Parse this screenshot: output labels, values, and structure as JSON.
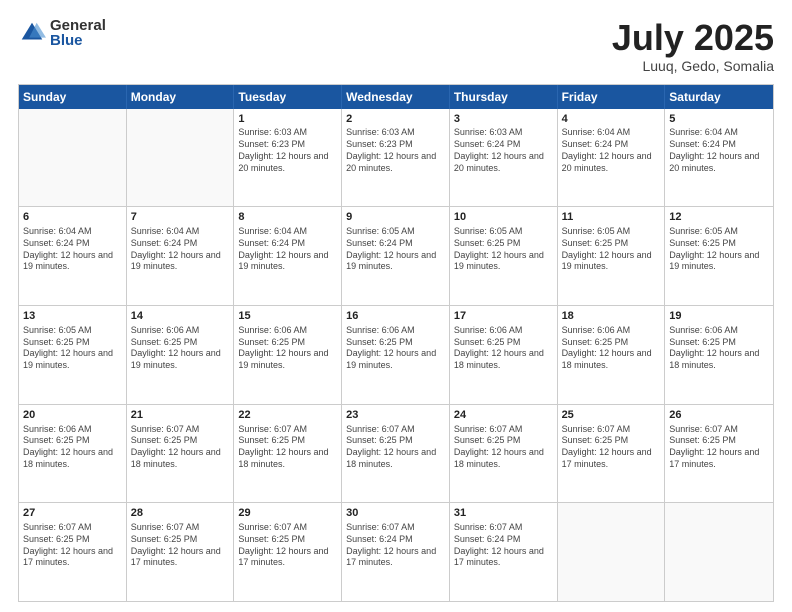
{
  "logo": {
    "general": "General",
    "blue": "Blue"
  },
  "title": "July 2025",
  "location": "Luuq, Gedo, Somalia",
  "days": [
    "Sunday",
    "Monday",
    "Tuesday",
    "Wednesday",
    "Thursday",
    "Friday",
    "Saturday"
  ],
  "weeks": [
    [
      {
        "day": "",
        "sunrise": "",
        "sunset": "",
        "daylight": ""
      },
      {
        "day": "",
        "sunrise": "",
        "sunset": "",
        "daylight": ""
      },
      {
        "day": "1",
        "sunrise": "Sunrise: 6:03 AM",
        "sunset": "Sunset: 6:23 PM",
        "daylight": "Daylight: 12 hours and 20 minutes."
      },
      {
        "day": "2",
        "sunrise": "Sunrise: 6:03 AM",
        "sunset": "Sunset: 6:23 PM",
        "daylight": "Daylight: 12 hours and 20 minutes."
      },
      {
        "day": "3",
        "sunrise": "Sunrise: 6:03 AM",
        "sunset": "Sunset: 6:24 PM",
        "daylight": "Daylight: 12 hours and 20 minutes."
      },
      {
        "day": "4",
        "sunrise": "Sunrise: 6:04 AM",
        "sunset": "Sunset: 6:24 PM",
        "daylight": "Daylight: 12 hours and 20 minutes."
      },
      {
        "day": "5",
        "sunrise": "Sunrise: 6:04 AM",
        "sunset": "Sunset: 6:24 PM",
        "daylight": "Daylight: 12 hours and 20 minutes."
      }
    ],
    [
      {
        "day": "6",
        "sunrise": "Sunrise: 6:04 AM",
        "sunset": "Sunset: 6:24 PM",
        "daylight": "Daylight: 12 hours and 19 minutes."
      },
      {
        "day": "7",
        "sunrise": "Sunrise: 6:04 AM",
        "sunset": "Sunset: 6:24 PM",
        "daylight": "Daylight: 12 hours and 19 minutes."
      },
      {
        "day": "8",
        "sunrise": "Sunrise: 6:04 AM",
        "sunset": "Sunset: 6:24 PM",
        "daylight": "Daylight: 12 hours and 19 minutes."
      },
      {
        "day": "9",
        "sunrise": "Sunrise: 6:05 AM",
        "sunset": "Sunset: 6:24 PM",
        "daylight": "Daylight: 12 hours and 19 minutes."
      },
      {
        "day": "10",
        "sunrise": "Sunrise: 6:05 AM",
        "sunset": "Sunset: 6:25 PM",
        "daylight": "Daylight: 12 hours and 19 minutes."
      },
      {
        "day": "11",
        "sunrise": "Sunrise: 6:05 AM",
        "sunset": "Sunset: 6:25 PM",
        "daylight": "Daylight: 12 hours and 19 minutes."
      },
      {
        "day": "12",
        "sunrise": "Sunrise: 6:05 AM",
        "sunset": "Sunset: 6:25 PM",
        "daylight": "Daylight: 12 hours and 19 minutes."
      }
    ],
    [
      {
        "day": "13",
        "sunrise": "Sunrise: 6:05 AM",
        "sunset": "Sunset: 6:25 PM",
        "daylight": "Daylight: 12 hours and 19 minutes."
      },
      {
        "day": "14",
        "sunrise": "Sunrise: 6:06 AM",
        "sunset": "Sunset: 6:25 PM",
        "daylight": "Daylight: 12 hours and 19 minutes."
      },
      {
        "day": "15",
        "sunrise": "Sunrise: 6:06 AM",
        "sunset": "Sunset: 6:25 PM",
        "daylight": "Daylight: 12 hours and 19 minutes."
      },
      {
        "day": "16",
        "sunrise": "Sunrise: 6:06 AM",
        "sunset": "Sunset: 6:25 PM",
        "daylight": "Daylight: 12 hours and 19 minutes."
      },
      {
        "day": "17",
        "sunrise": "Sunrise: 6:06 AM",
        "sunset": "Sunset: 6:25 PM",
        "daylight": "Daylight: 12 hours and 18 minutes."
      },
      {
        "day": "18",
        "sunrise": "Sunrise: 6:06 AM",
        "sunset": "Sunset: 6:25 PM",
        "daylight": "Daylight: 12 hours and 18 minutes."
      },
      {
        "day": "19",
        "sunrise": "Sunrise: 6:06 AM",
        "sunset": "Sunset: 6:25 PM",
        "daylight": "Daylight: 12 hours and 18 minutes."
      }
    ],
    [
      {
        "day": "20",
        "sunrise": "Sunrise: 6:06 AM",
        "sunset": "Sunset: 6:25 PM",
        "daylight": "Daylight: 12 hours and 18 minutes."
      },
      {
        "day": "21",
        "sunrise": "Sunrise: 6:07 AM",
        "sunset": "Sunset: 6:25 PM",
        "daylight": "Daylight: 12 hours and 18 minutes."
      },
      {
        "day": "22",
        "sunrise": "Sunrise: 6:07 AM",
        "sunset": "Sunset: 6:25 PM",
        "daylight": "Daylight: 12 hours and 18 minutes."
      },
      {
        "day": "23",
        "sunrise": "Sunrise: 6:07 AM",
        "sunset": "Sunset: 6:25 PM",
        "daylight": "Daylight: 12 hours and 18 minutes."
      },
      {
        "day": "24",
        "sunrise": "Sunrise: 6:07 AM",
        "sunset": "Sunset: 6:25 PM",
        "daylight": "Daylight: 12 hours and 18 minutes."
      },
      {
        "day": "25",
        "sunrise": "Sunrise: 6:07 AM",
        "sunset": "Sunset: 6:25 PM",
        "daylight": "Daylight: 12 hours and 17 minutes."
      },
      {
        "day": "26",
        "sunrise": "Sunrise: 6:07 AM",
        "sunset": "Sunset: 6:25 PM",
        "daylight": "Daylight: 12 hours and 17 minutes."
      }
    ],
    [
      {
        "day": "27",
        "sunrise": "Sunrise: 6:07 AM",
        "sunset": "Sunset: 6:25 PM",
        "daylight": "Daylight: 12 hours and 17 minutes."
      },
      {
        "day": "28",
        "sunrise": "Sunrise: 6:07 AM",
        "sunset": "Sunset: 6:25 PM",
        "daylight": "Daylight: 12 hours and 17 minutes."
      },
      {
        "day": "29",
        "sunrise": "Sunrise: 6:07 AM",
        "sunset": "Sunset: 6:25 PM",
        "daylight": "Daylight: 12 hours and 17 minutes."
      },
      {
        "day": "30",
        "sunrise": "Sunrise: 6:07 AM",
        "sunset": "Sunset: 6:24 PM",
        "daylight": "Daylight: 12 hours and 17 minutes."
      },
      {
        "day": "31",
        "sunrise": "Sunrise: 6:07 AM",
        "sunset": "Sunset: 6:24 PM",
        "daylight": "Daylight: 12 hours and 17 minutes."
      },
      {
        "day": "",
        "sunrise": "",
        "sunset": "",
        "daylight": ""
      },
      {
        "day": "",
        "sunrise": "",
        "sunset": "",
        "daylight": ""
      }
    ]
  ]
}
